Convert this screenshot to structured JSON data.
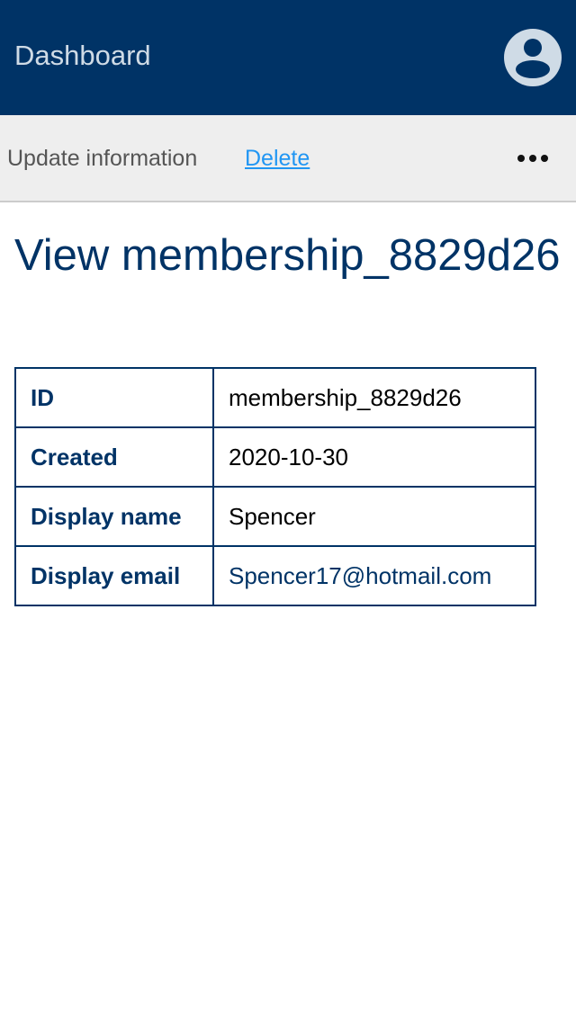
{
  "header": {
    "title": "Dashboard",
    "avatar_icon": "account-circle-icon",
    "bg_color": "#003366"
  },
  "toolbar": {
    "update_label": "Update information",
    "delete_label": "Delete",
    "more_icon": "more-horizontal-icon"
  },
  "page": {
    "title": "View membership_8829d26"
  },
  "details": [
    {
      "label": "ID",
      "value": "membership_8829d26"
    },
    {
      "label": "Created",
      "value": "2020-10-30"
    },
    {
      "label": "Display name",
      "value": "Spencer"
    },
    {
      "label": "Display email",
      "value": "Spencer17@hotmail.com"
    }
  ]
}
